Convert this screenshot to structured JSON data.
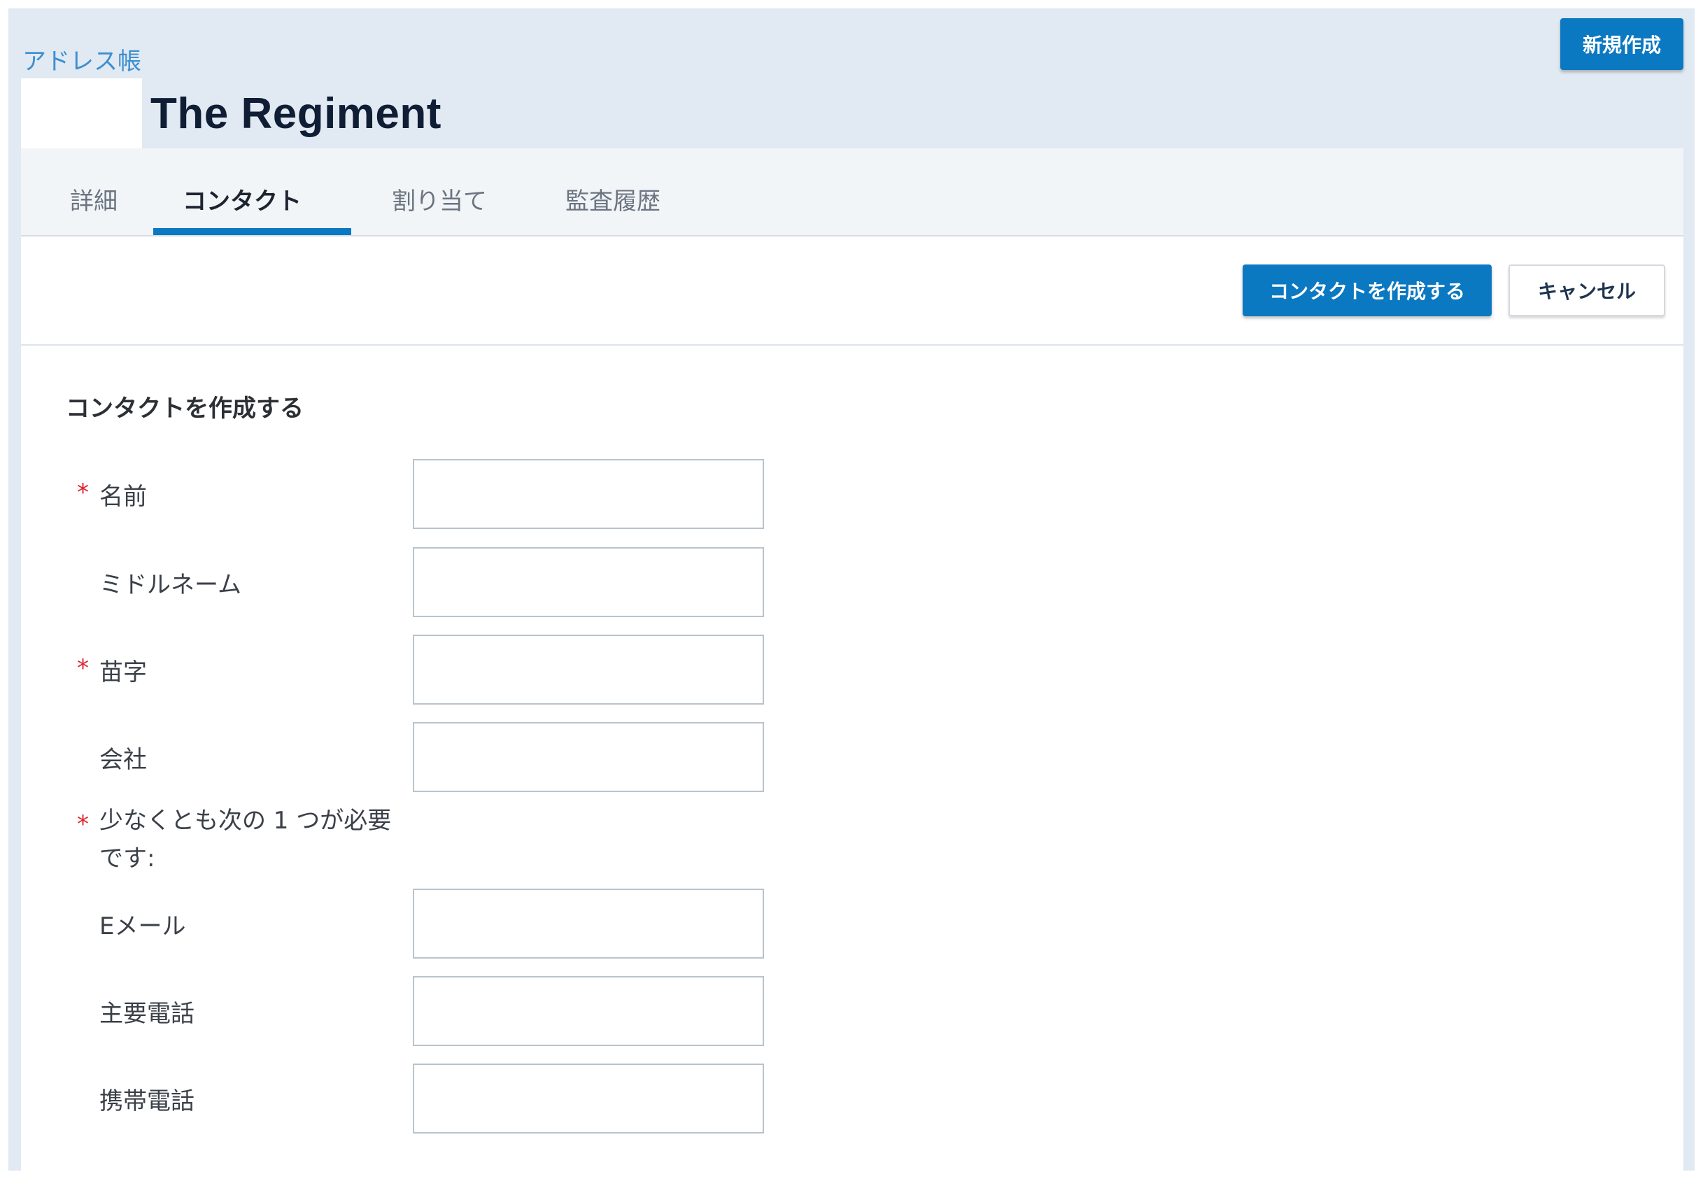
{
  "header": {
    "breadcrumb": "アドレス帳",
    "title": "The Regiment",
    "new_button": "新規作成"
  },
  "tabs": [
    {
      "label": "詳細",
      "active": false
    },
    {
      "label": "コンタクト",
      "active": true
    },
    {
      "label": "割り当て",
      "active": false
    },
    {
      "label": "監査履歴",
      "active": false
    }
  ],
  "toolbar": {
    "create_label": "コンタクトを作成する",
    "cancel_label": "キャンセル"
  },
  "form": {
    "title": "コンタクトを作成する",
    "required_mark": "*",
    "fields": {
      "first_name": {
        "label": "名前",
        "value": ""
      },
      "middle_name": {
        "label": "ミドルネーム",
        "value": ""
      },
      "last_name": {
        "label": "苗字",
        "value": ""
      },
      "company": {
        "label": "会社",
        "value": ""
      },
      "email": {
        "label": "Eメール",
        "value": ""
      },
      "main_phone": {
        "label": "主要電話",
        "value": ""
      },
      "mobile_phone": {
        "label": "携帯電話",
        "value": ""
      }
    },
    "at_least_one_line1": "少なくとも次の 1 つが必要",
    "at_least_one_line2": "です:"
  },
  "colors": {
    "primary": "#0b78c2",
    "header_bg": "#e1e9f2",
    "required": "#d9272e",
    "link": "#3b8fd0"
  }
}
